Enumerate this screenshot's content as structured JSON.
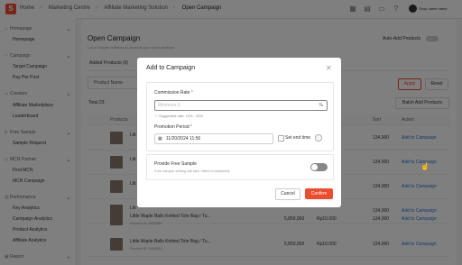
{
  "topbar": {
    "logo": "S",
    "breadcrumbs": [
      "Home",
      "Marketing Centre",
      "Affiliate Marketing Solution",
      "Open Campaign"
    ],
    "shop_name": "Shop name name"
  },
  "sidebar": {
    "sections": [
      {
        "label": "Homepage",
        "items": [
          "Homepage"
        ]
      },
      {
        "label": "Campaign",
        "items": [
          "Target Campaign",
          "Pay Per Post"
        ]
      },
      {
        "label": "Creators",
        "items": [
          "Affiliate Marketplace",
          "Leaderboard"
        ]
      },
      {
        "label": "Free Sample",
        "items": [
          "Sample Request"
        ]
      },
      {
        "label": "MCN Partner",
        "items": [
          "Find MCN",
          "MCN Campaign"
        ]
      },
      {
        "label": "Performance",
        "items": [
          "Key Analytics",
          "Campaign Analytics",
          "Product Analytics",
          "Affiliate Analytics"
        ]
      },
      {
        "label": "Report",
        "items": []
      }
    ]
  },
  "main": {
    "title": "Open Campaign",
    "description": "Lot of Shopee Affiliates to promote your store products",
    "auto_add_label": "Auto-Add Products",
    "auto_add_state": "OFF",
    "tab": "Added Products (0)",
    "filter_label": "Product Name",
    "apply_label": "Apply",
    "reset_label": "Reset",
    "total": "Total 23",
    "batch_label": "Batch Add Products",
    "columns": {
      "product": "Products",
      "sort": "Sort",
      "action": "Action"
    },
    "rows": [
      {
        "name": "Litt",
        "sub": "",
        "sales": "",
        "price": "",
        "sort": "134,000",
        "action": "Add to Campaign"
      },
      {
        "name": "Litt",
        "sub": "",
        "sales": "",
        "price": "",
        "sort": "134,000",
        "action": "Add to Campaign"
      },
      {
        "name": "Litt",
        "sub": "",
        "sales": "",
        "price": "",
        "sort": "134,000",
        "action": "Add to Campaign"
      },
      {
        "name": "Litt",
        "sub": "",
        "sales": "",
        "price": "",
        "sort": "134,000",
        "action": "Add to Campaign"
      },
      {
        "name": "Little Maple Balls Knitted Tote Bag / Tu...",
        "sub": "Product ID 1859283",
        "sales": "5,859,000",
        "price": "Rp10.000",
        "sort": "134,000",
        "action": "Add to Campaign"
      },
      {
        "name": "Little Maple Balls Knitted Tote Bag / Tu...",
        "sub": "Product ID 1859283",
        "sales": "5,859,000",
        "price": "Rp10.000",
        "sort": "134,000",
        "action": "Add to Campaign"
      }
    ]
  },
  "modal": {
    "title": "Add to Campaign",
    "commission_label": "Commission Rate",
    "commission_placeholder": "Minimum 3",
    "commission_unit": "%",
    "commission_hint": "Suggested rate: 10% - 15%",
    "period_label": "Promotion Period",
    "period_value": "11/20/2024 11:56",
    "set_end_time": "Set end time",
    "free_sample_title": "Provide Free Sample",
    "free_sample_desc": "Free sample setting will take effect immediately",
    "cancel_label": "Cancel",
    "confirm_label": "Confirm",
    "required_mark": "*",
    "close_icon": "close-icon"
  },
  "colors": {
    "accent": "#ee4d2d",
    "link": "#2673dd"
  }
}
